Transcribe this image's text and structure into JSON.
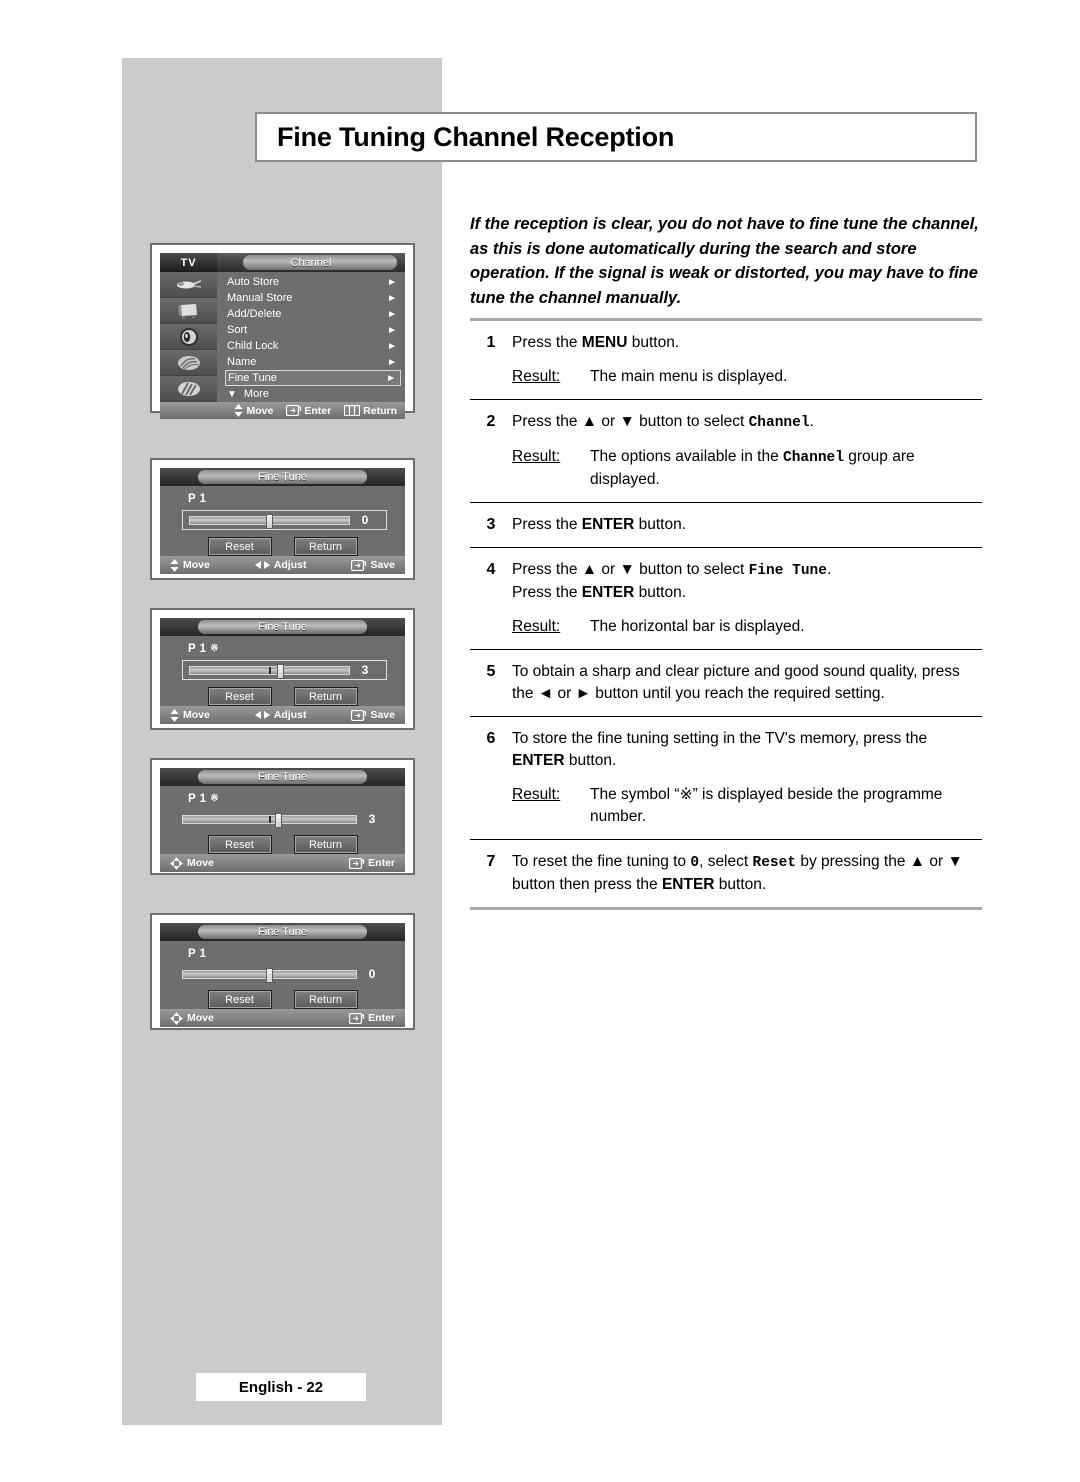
{
  "page": {
    "title": "Fine Tuning Channel Reception",
    "footer": "English - 22",
    "intro": "If the reception is clear, you do not have to fine tune the channel, as this is done automatically during the search and store operation. If the signal is weak or distorted, you may have to fine tune the channel manually."
  },
  "steps": [
    {
      "num": "1",
      "line1_a": "Press the ",
      "line1_kbd": "MENU",
      "line1_b": " button.",
      "result_label": "Result:",
      "result_text": "The main menu is displayed."
    },
    {
      "num": "2",
      "line1_a": "Press the ▲ or ▼ button to select ",
      "line1_mono": "Channel",
      "line1_b": ".",
      "result_label": "Result:",
      "result_a": "The options available in the ",
      "result_mono": "Channel",
      "result_b": " group are displayed."
    },
    {
      "num": "3",
      "line1_a": "Press the ",
      "line1_kbd": "ENTER",
      "line1_b": " button."
    },
    {
      "num": "4",
      "line1_a": "Press the ▲ or ▼ button to select ",
      "line1_mono": "Fine Tune",
      "line1_b": ".",
      "line2_a": "Press the ",
      "line2_kbd": "ENTER",
      "line2_b": " button.",
      "result_label": "Result:",
      "result_text": "The horizontal bar is displayed."
    },
    {
      "num": "5",
      "line1_a": "To obtain a sharp and clear picture and good sound quality, press the ◄ or ► button until you reach the required setting."
    },
    {
      "num": "6",
      "line1_a": "To store the fine tuning setting in the TV's memory, press the ",
      "line1_kbd": "ENTER",
      "line1_b": " button.",
      "result_label": "Result:",
      "result_a": "The symbol “※” is displayed beside the programme number."
    },
    {
      "num": "7",
      "line1_a": "To reset the fine tuning to ",
      "line1_mono": "0",
      "line1_b": ", select ",
      "line1_mono2": "Reset",
      "line1_c": " by pressing the ▲ or ▼ button then press the ",
      "line1_kbd": "ENTER",
      "line1_d": " button."
    }
  ],
  "figures": {
    "menu": {
      "tv_label": "TV",
      "title": "Channel",
      "items": [
        {
          "label": "Auto Store",
          "arrow": "►",
          "selected": false
        },
        {
          "label": "Manual Store",
          "arrow": "►",
          "selected": false
        },
        {
          "label": "Add/Delete",
          "arrow": "►",
          "selected": false
        },
        {
          "label": "Sort",
          "arrow": "►",
          "selected": false
        },
        {
          "label": "Child Lock",
          "arrow": "►",
          "selected": false
        },
        {
          "label": "Name",
          "arrow": "►",
          "selected": false
        },
        {
          "label": "Fine Tune",
          "arrow": "►",
          "selected": true
        }
      ],
      "more": {
        "icon": "▼",
        "label": "More"
      },
      "bottom": [
        {
          "icon": "updown",
          "label": "Move"
        },
        {
          "icon": "enter",
          "label": "Enter"
        },
        {
          "icon": "return",
          "label": "Return"
        }
      ]
    },
    "finetune_1": {
      "title": "Fine Tune",
      "programme": "P 1",
      "asterisk": "",
      "value": "0",
      "knob_percent": 50,
      "tick_percent": null,
      "boxed": true,
      "buttons": [
        "Reset",
        "Return"
      ],
      "bottom": [
        {
          "icon": "updown",
          "label": "Move"
        },
        {
          "icon": "leftright",
          "label": "Adjust"
        },
        {
          "icon": "enter",
          "label": "Save"
        }
      ]
    },
    "finetune_2": {
      "title": "Fine Tune",
      "programme": "P 1",
      "asterisk": "※",
      "value": "3",
      "knob_percent": 57,
      "tick_percent": 50,
      "boxed": true,
      "buttons": [
        "Reset",
        "Return"
      ],
      "bottom": [
        {
          "icon": "updown",
          "label": "Move"
        },
        {
          "icon": "leftright",
          "label": "Adjust"
        },
        {
          "icon": "enter",
          "label": "Save"
        }
      ]
    },
    "finetune_3": {
      "title": "Fine Tune",
      "programme": "P 1",
      "asterisk": "※",
      "value": "3",
      "knob_percent": 55,
      "tick_percent": 50,
      "boxed": false,
      "buttons": [
        "Reset",
        "Return"
      ],
      "bottom": [
        {
          "icon": "pad",
          "label": "Move"
        },
        {
          "icon": "enter",
          "label": "Enter"
        }
      ]
    },
    "finetune_4": {
      "title": "Fine Tune",
      "programme": "P 1",
      "asterisk": "",
      "value": "0",
      "knob_percent": 50,
      "tick_percent": null,
      "boxed": false,
      "buttons": [
        "Reset",
        "Return"
      ],
      "bottom": [
        {
          "icon": "pad",
          "label": "Move"
        },
        {
          "icon": "enter",
          "label": "Enter"
        }
      ]
    }
  },
  "colors": {
    "band": "#cbcbcb",
    "osd_body": "#6e6e6e",
    "rule": "#a8a8a8"
  }
}
